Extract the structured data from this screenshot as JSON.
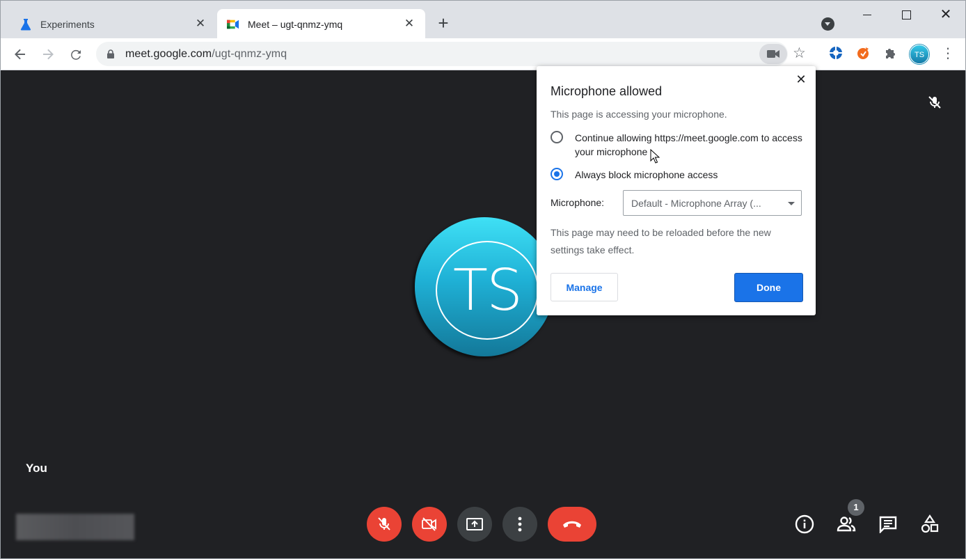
{
  "tabs": [
    {
      "title": "Experiments",
      "icon": "flask-icon",
      "active": false
    },
    {
      "title": "Meet – ugt-qnmz-ymq",
      "icon": "google-meet-icon",
      "active": true
    }
  ],
  "toolbar": {
    "url_domain": "meet.google.com",
    "url_path": "/ugt-qnmz-ymq",
    "profile_initials": "TS"
  },
  "meet": {
    "avatar_initials": "TS",
    "self_label": "You",
    "participant_count": "1"
  },
  "popup": {
    "title": "Microphone allowed",
    "description": "This page is accessing your microphone.",
    "options": [
      {
        "label": "Continue allowing https://meet.google.com to access your microphone",
        "selected": false
      },
      {
        "label": "Always block microphone access",
        "selected": true
      }
    ],
    "microphone_label": "Microphone:",
    "microphone_value": "Default - Microphone Array (...",
    "reload_note": "This page may need to be reloaded before the new settings take effect.",
    "manage_label": "Manage",
    "done_label": "Done"
  },
  "colors": {
    "accent": "#1a73e8",
    "danger": "#ea4335",
    "meet_bg": "#202124",
    "avatar": "#1fb1d6"
  }
}
